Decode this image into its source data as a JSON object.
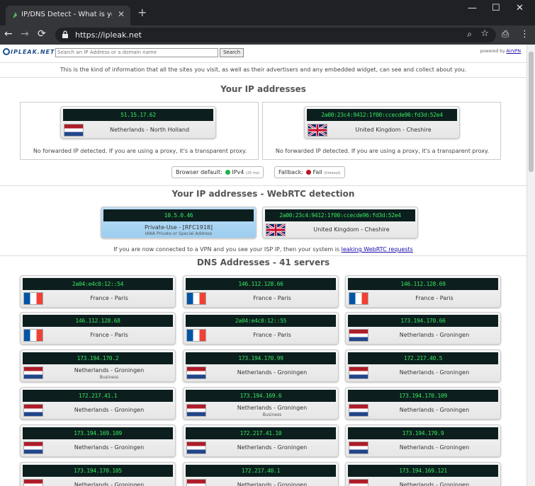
{
  "browser": {
    "tab_title": "IP/DNS Detect - What is your IP,",
    "url": "https://ipleak.net"
  },
  "header": {
    "logo": "IPLEAK.NET",
    "search_placeholder": "Search an IP Address or a domain name",
    "search_button": "Search",
    "powered_prefix": "powered by",
    "powered_link": "AirVPN",
    "intro": "This is the kind of information that all the sites you visit, as well as their advertisers and any embedded widget, can see and collect about you."
  },
  "ip_section": {
    "title": "Your IP addresses",
    "items": [
      {
        "ip": "51.15.17.62",
        "flag": "nl",
        "location": "Netherlands - North Holland",
        "note": "No forwarded IP detected. If you are using a proxy, it's a transparent proxy."
      },
      {
        "ip": "2a00:23c4:9412:1f00:ccecde96:fd3d:52e4",
        "flag": "uk",
        "location": "United Kingdom - Cheshire",
        "note": "No forwarded IP detected. If you are using a proxy, it's a transparent proxy."
      }
    ],
    "browser_default_label": "Browser default:",
    "browser_default_value": "IPv4",
    "browser_default_time": "(25 ms)",
    "fallback_label": "Fallback:",
    "fallback_value": "Fail",
    "fallback_note": "(timeout)",
    "colors": {
      "ok": "#22b14c",
      "fail": "#c0141e"
    }
  },
  "webrtc": {
    "title": "Your IP addresses - WebRTC detection",
    "items": [
      {
        "ip": "10.5.0.46",
        "location": "Private-Use - [RFC1918]",
        "sub": "IANA Private or Special Address"
      },
      {
        "ip": "2a00:23c4:9412:1f00:ccecde96:fd3d:52e4",
        "flag": "uk",
        "location": "United Kingdom - Cheshire"
      }
    ],
    "leak_text": "If you are now connected to a VPN and you see your ISP IP, then your system is",
    "leak_link": "leaking WebRTC requests"
  },
  "dns": {
    "title": "DNS Addresses - 41 servers",
    "servers": [
      {
        "ip": "2a04:e4c0:12::54",
        "flag": "fr",
        "location": "France - Paris"
      },
      {
        "ip": "146.112.128.66",
        "flag": "fr",
        "location": "France - Paris"
      },
      {
        "ip": "146.112.128.69",
        "flag": "fr",
        "location": "France - Paris"
      },
      {
        "ip": "146.112.128.68",
        "flag": "fr",
        "location": "France - Paris"
      },
      {
        "ip": "2a04:e4c0:12::55",
        "flag": "fr",
        "location": "France - Paris"
      },
      {
        "ip": "173.194.170.66",
        "flag": "nl",
        "location": "Netherlands - Groningen"
      },
      {
        "ip": "173.194.170.2",
        "flag": "nl",
        "location": "Netherlands - Groningen",
        "sub": "Business"
      },
      {
        "ip": "173.194.170.99",
        "flag": "nl",
        "location": "Netherlands - Groningen"
      },
      {
        "ip": "172.217.40.5",
        "flag": "nl",
        "location": "Netherlands - Groningen"
      },
      {
        "ip": "172.217.41.1",
        "flag": "nl",
        "location": "Netherlands - Groningen"
      },
      {
        "ip": "173.194.169.6",
        "flag": "nl",
        "location": "Netherlands - Groningen",
        "sub": "Business"
      },
      {
        "ip": "173.194.170.109",
        "flag": "nl",
        "location": "Netherlands - Groningen"
      },
      {
        "ip": "173.194.169.109",
        "flag": "nl",
        "location": "Netherlands - Groningen"
      },
      {
        "ip": "172.217.41.10",
        "flag": "nl",
        "location": "Netherlands - Groningen"
      },
      {
        "ip": "173.194.170.9",
        "flag": "nl",
        "location": "Netherlands - Groningen"
      },
      {
        "ip": "173.194.170.105",
        "flag": "nl",
        "location": "Netherlands - Groningen"
      },
      {
        "ip": "172.217.40.1",
        "flag": "nl",
        "location": "Netherlands - Groningen"
      },
      {
        "ip": "173.194.169.121",
        "flag": "nl",
        "location": "Netherlands - Groningen"
      }
    ]
  }
}
